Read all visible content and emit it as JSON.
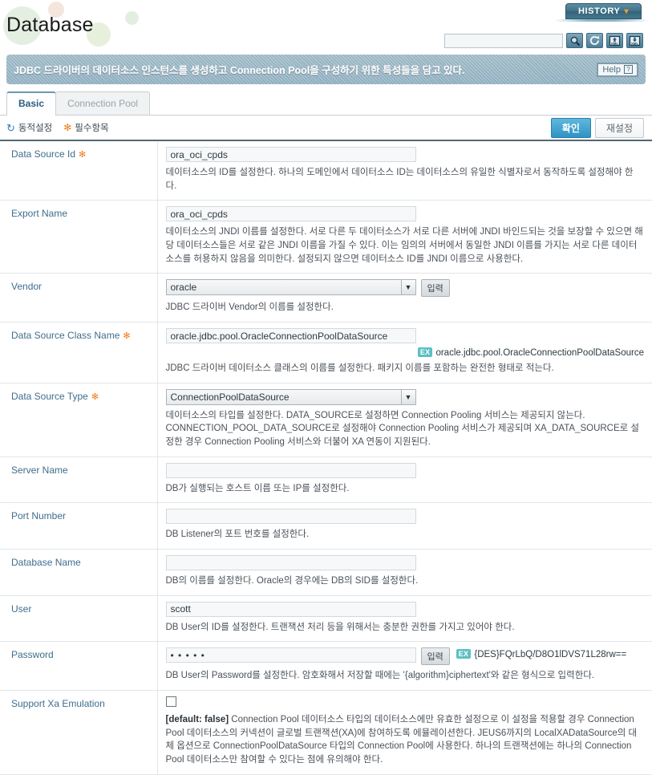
{
  "header": {
    "app_title": "Database",
    "history_label": "HISTORY",
    "history_caret": "⌄",
    "search_value": "",
    "search_placeholder": "",
    "tools": [
      {
        "name": "search-icon",
        "title": "search"
      },
      {
        "name": "refresh-icon",
        "title": "refresh"
      },
      {
        "name": "xml-upload-icon",
        "title": "XML upload"
      },
      {
        "name": "xml-download-icon",
        "title": "XML download"
      }
    ]
  },
  "description": {
    "text": "JDBC 드라이버의 데이터소스 인스턴스를 생성하고 Connection Pool을 구성하기 위한 특성들을 담고 있다.",
    "help_label": "Help",
    "help_mark": "?"
  },
  "tabs": [
    {
      "label": "Basic",
      "active": true
    },
    {
      "label": "Connection Pool",
      "active": false
    }
  ],
  "legend": {
    "dynamic_icon": "↻",
    "dynamic_label": "동적설정",
    "required_icon": "✻",
    "required_label": "필수항목",
    "confirm_label": "확인",
    "reset_label": "재설정"
  },
  "colors": {
    "accent": "#2f93c4",
    "label_text": "#3f6d8c",
    "required_star": "#ef7d1a",
    "banner": "#9db8c4",
    "ex_badge": "#5bc0c4"
  },
  "fields": [
    {
      "label": "Data Source Id",
      "required": true,
      "control": "text",
      "value": "ora_oci_cpds",
      "hint": "데이터소스의 ID를 설정한다. 하나의 도메인에서 데이터소스 ID는 데이터소스의 유일한 식별자로서 동작하도록 설정해야 한다."
    },
    {
      "label": "Export Name",
      "required": false,
      "control": "text",
      "value": "ora_oci_cpds",
      "hint": "데이터소스의 JNDI 이름를 설정한다. 서로 다른 두 데이터소스가 서로 다른 서버에 JNDI 바인드되는 것을 보장할 수 있으면 해당 데이터소스들은 서로 같은 JNDI 이름을 가질 수 있다. 이는 임의의 서버에서 동일한 JNDI 이름를 가지는 서로 다른 데이터소스를 허용하지 않음을 의미한다. 설정되지 않으면 데이터소스 ID를 JNDI 이름으로 사용한다."
    },
    {
      "label": "Vendor",
      "required": false,
      "control": "select",
      "value": "oracle",
      "button_label": "입력",
      "hint": "JDBC 드라이버 Vendor의 이름를 설정한다."
    },
    {
      "label": "Data Source Class Name",
      "required": true,
      "control": "text",
      "value": "oracle.jdbc.pool.OracleConnectionPoolDataSource",
      "example_badge": "EX",
      "example": "oracle.jdbc.pool.OracleConnectionPoolDataSource",
      "hint": "JDBC 드라이버 데이터소스 클래스의 이름를 설정한다. 패키지 이름를 포함하는 완전한 형태로 적는다."
    },
    {
      "label": "Data Source Type",
      "required": true,
      "control": "select",
      "value": "ConnectionPoolDataSource",
      "hint": "데이터소스의 타입를 설정한다. DATA_SOURCE로 설정하면 Connection Pooling 서비스는 제공되지 않는다. CONNECTION_POOL_DATA_SOURCE로 설정해야 Connection Pooling 서비스가 제공되며 XA_DATA_SOURCE로 설정한 경우 Connection Pooling 서비스와 더불어 XA 연동이 지원된다."
    },
    {
      "label": "Server Name",
      "required": false,
      "control": "text",
      "value": "",
      "hint": "DB가 실행되는 호스트 이름 또는 IP를 설정한다."
    },
    {
      "label": "Port Number",
      "required": false,
      "control": "text",
      "value": "",
      "hint": "DB Listener의 포트 번호를 설정한다."
    },
    {
      "label": "Database Name",
      "required": false,
      "control": "text",
      "value": "",
      "hint": "DB의 이름를 설정한다. Oracle의 경우에는 DB의 SID를 설정한다."
    },
    {
      "label": "User",
      "required": false,
      "control": "text",
      "value": "scott",
      "hint": "DB User의 ID를 설정한다. 트랜잭션 처리 등을 위해서는 충분한 권한를 가지고 있어야 한다."
    },
    {
      "label": "Password",
      "required": false,
      "control": "password",
      "value": "• • • • •",
      "button_label": "입력",
      "example_badge": "EX",
      "example": "{DES}FQrLbQ/D8O1lDVS71L28rw==",
      "hint": "DB User의 Password를 설정한다. 암호화해서 저장할 때에는 '{algorithm}ciphertext'와 같은 형식으로 입력한다."
    },
    {
      "label": "Support Xa Emulation",
      "required": false,
      "control": "checkbox",
      "checked": false,
      "default_tag": "[default: false]",
      "hint": "Connection Pool 데이터소스 타입의 데이터소스에만 유효한 설정으로 이 설정을 적용할 경우 Connection Pool 데이터소스의 커넥션이 글로벌 트랜잭션(XA)에 참여하도록 에뮬레이션한다. JEUS6까지의 LocalXADataSource의 대체 옵션으로 ConnectionPoolDataSource 타입의 Connection Pool에 사용한다. 하나의 트랜잭션에는 하나의 Connection Pool 데이터소스만 참여할 수 있다는 점에 유의해야 한다."
    }
  ]
}
